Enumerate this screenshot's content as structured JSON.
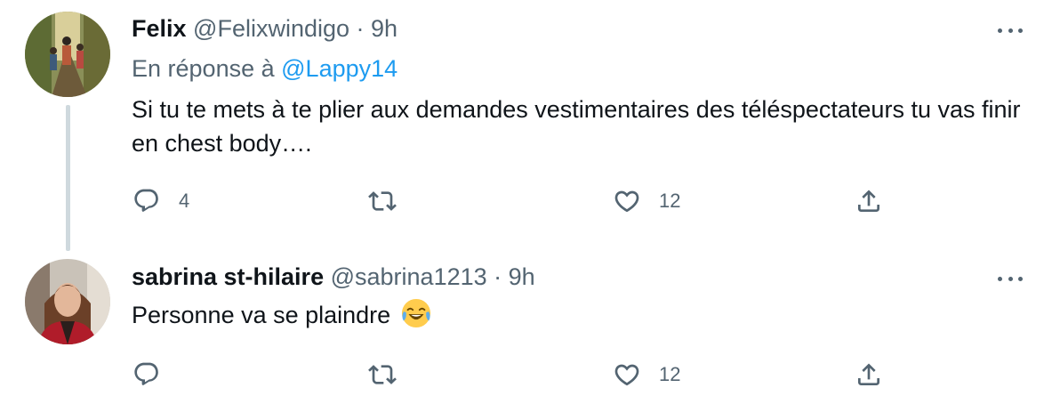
{
  "tweets": [
    {
      "name": "Felix",
      "handle": "@Felixwindigo",
      "time": "· 9h",
      "reply_prefix": "En réponse à",
      "reply_handle": "@Lappy14",
      "text": "Si tu te mets à te plier aux demandes vestimentaires des téléspectateurs tu vas finir en chest body….",
      "replies": "4",
      "retweets": "",
      "likes": "12"
    },
    {
      "name": "sabrina st-hilaire",
      "handle": "@sabrina1213",
      "time": "· 9h",
      "text": "Personne va se plaindre",
      "emoji": "face-with-tears-of-joy",
      "replies": "",
      "retweets": "",
      "likes": "12"
    }
  ],
  "colors": {
    "text": "#0f1419",
    "secondary": "#536471",
    "link": "#1d9bf0",
    "thread_line": "#cfd9de"
  }
}
